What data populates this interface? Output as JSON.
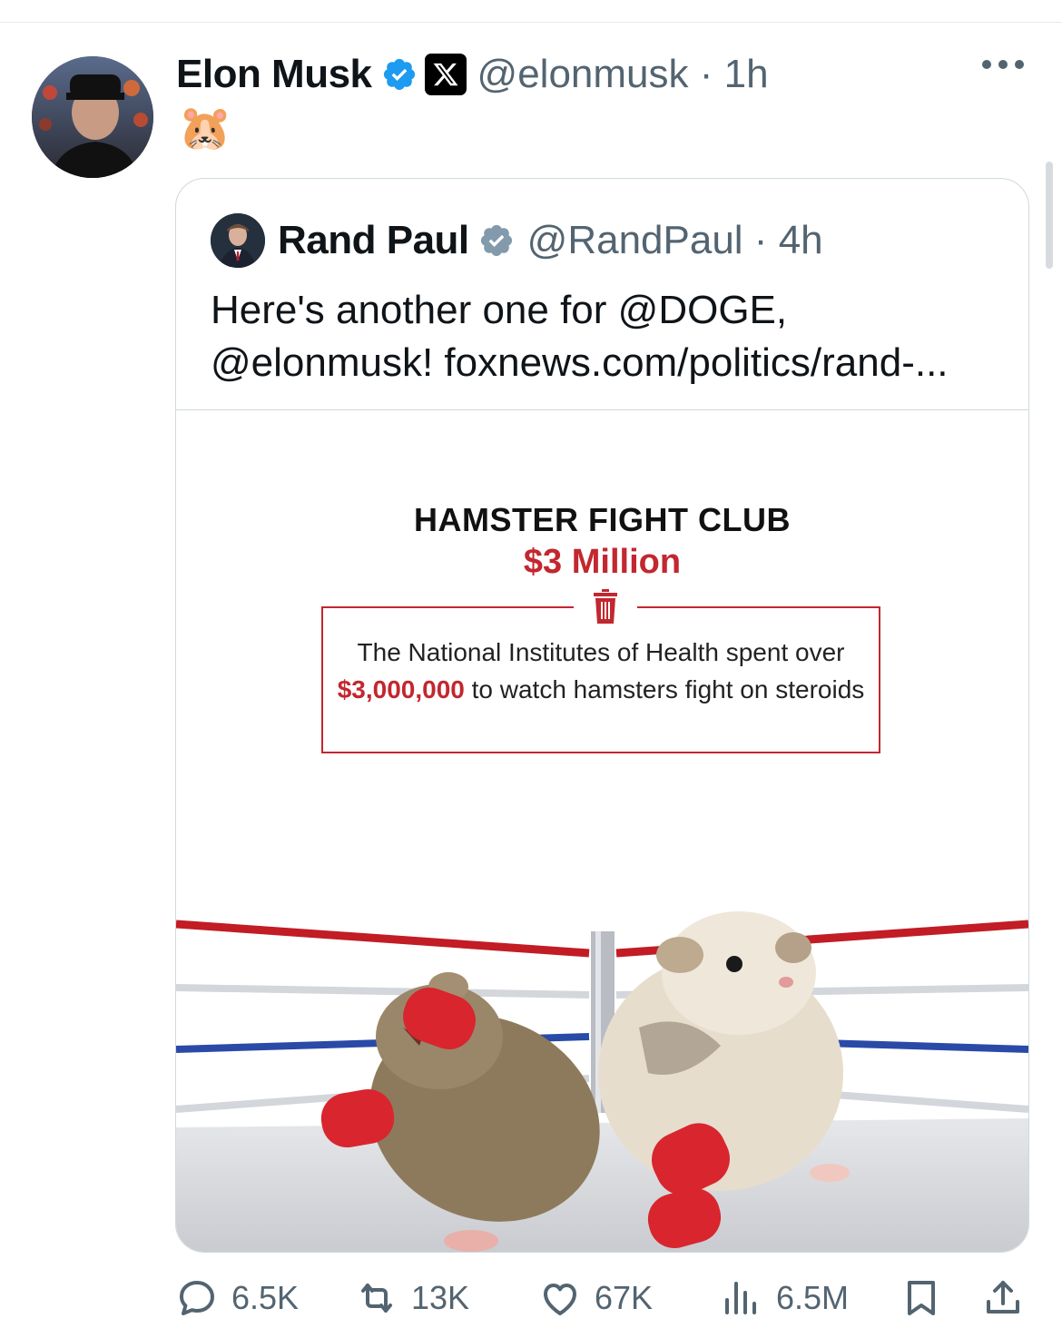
{
  "tweet": {
    "author_name": "Elon Musk",
    "handle": "@elonmusk",
    "time": "1h",
    "body": "🐹"
  },
  "quote": {
    "author_name": "Rand Paul",
    "handle": "@RandPaul",
    "time": "4h",
    "text_line1": "Here's another one for @DOGE,",
    "text_line2": "@elonmusk! foxnews.com/politics/rand-...",
    "media": {
      "title": "HAMSTER FIGHT CLUB",
      "subtitle": "$3 Million",
      "desc_pre": "The National Institutes of Health spent over ",
      "desc_amount": "$3,000,000",
      "desc_post": " to watch hamsters fight on steroids"
    }
  },
  "actions": {
    "replies": "6.5K",
    "reposts": "13K",
    "likes": "67K",
    "views": "6.5M"
  },
  "colors": {
    "verified": "#1d9bf0",
    "accent_red": "#c3272f",
    "muted": "#536471"
  }
}
